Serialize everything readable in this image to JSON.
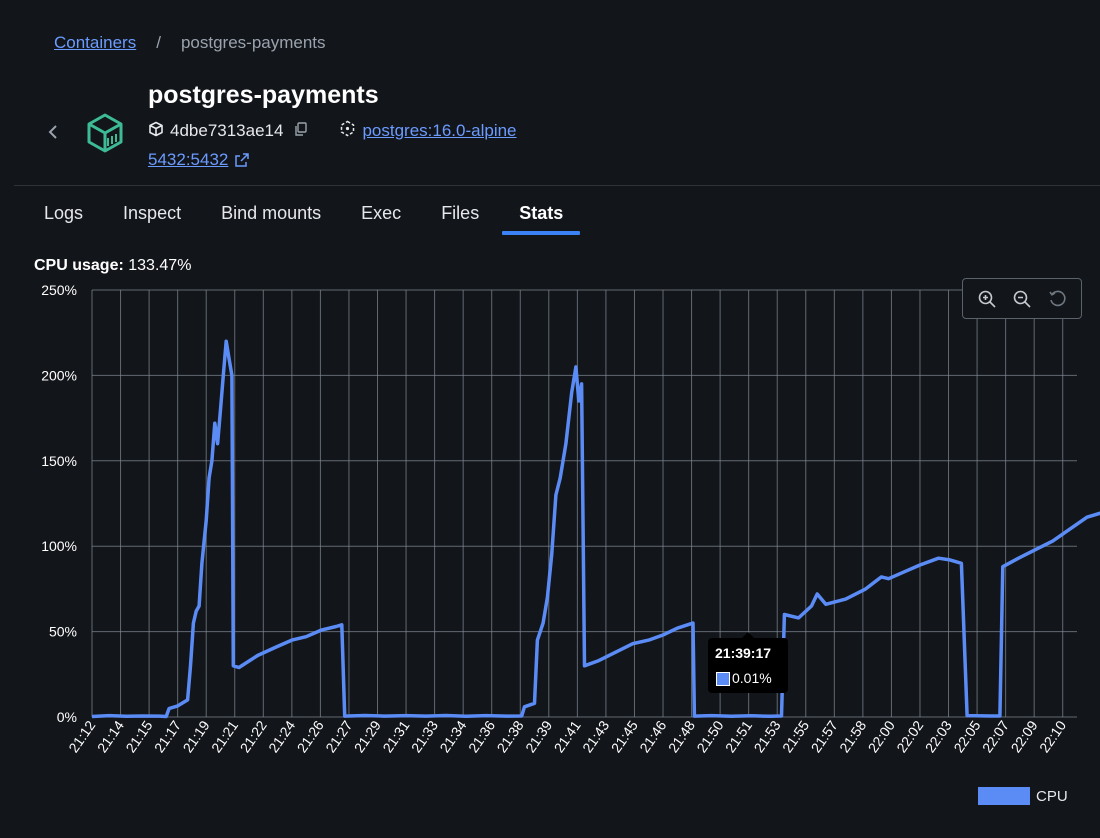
{
  "breadcrumb": {
    "root": "Containers",
    "separator": "/",
    "current": "postgres-payments"
  },
  "container": {
    "name": "postgres-payments",
    "id": "4dbe7313ae14",
    "image": "postgres:16.0-alpine",
    "port": "5432:5432",
    "icon": "container-box-icon"
  },
  "tabs": [
    {
      "label": "Logs",
      "active": false
    },
    {
      "label": "Inspect",
      "active": false
    },
    {
      "label": "Bind mounts",
      "active": false
    },
    {
      "label": "Exec",
      "active": false
    },
    {
      "label": "Files",
      "active": false
    },
    {
      "label": "Stats",
      "active": true
    }
  ],
  "stats": {
    "cpu_label": "CPU usage:",
    "cpu_value": "133.47%"
  },
  "tooltip": {
    "time": "21:39:17",
    "value": "0.01%"
  },
  "colors": {
    "accent": "#3b82f6",
    "series": "#5b8cf5",
    "background": "#12151a"
  },
  "chart_data": {
    "type": "line",
    "ylim": [
      0,
      250
    ],
    "y_ticks": [
      "0%",
      "50%",
      "100%",
      "150%",
      "200%",
      "250%"
    ],
    "x_ticks": [
      "21:12",
      "21:14",
      "21:15",
      "21:17",
      "21:19",
      "21:21",
      "21:22",
      "21:24",
      "21:26",
      "21:27",
      "21:29",
      "21:31",
      "21:33",
      "21:34",
      "21:36",
      "21:38",
      "21:39",
      "21:41",
      "21:43",
      "21:45",
      "21:46",
      "21:48",
      "21:50",
      "21:51",
      "21:53",
      "21:55",
      "21:57",
      "21:58",
      "22:00",
      "22:02",
      "22:03",
      "22:05",
      "22:07",
      "22:09",
      "22:10"
    ],
    "grid": true,
    "legend": "bottom-right",
    "series": [
      {
        "name": "CPU",
        "points": [
          [
            0.0,
            0.3
          ],
          [
            1.2,
            0.8
          ],
          [
            2.4,
            0.4
          ],
          [
            3.5,
            0.6
          ],
          [
            4.7,
            0.5
          ],
          [
            5.2,
            0.3
          ],
          [
            5.4,
            5
          ],
          [
            6.0,
            6.5
          ],
          [
            6.6,
            9.5
          ],
          [
            6.7,
            10
          ],
          [
            6.9,
            30
          ],
          [
            7.1,
            55
          ],
          [
            7.3,
            62
          ],
          [
            7.5,
            65
          ],
          [
            7.7,
            90
          ],
          [
            8.0,
            115
          ],
          [
            8.2,
            140
          ],
          [
            8.4,
            150
          ],
          [
            8.6,
            172
          ],
          [
            8.8,
            160
          ],
          [
            9.0,
            180
          ],
          [
            9.2,
            200
          ],
          [
            9.4,
            220
          ],
          [
            9.6,
            210
          ],
          [
            9.8,
            200
          ],
          [
            9.9,
            30
          ],
          [
            10.3,
            29
          ],
          [
            11.6,
            36
          ],
          [
            12.9,
            41
          ],
          [
            14.0,
            45
          ],
          [
            15.0,
            47
          ],
          [
            16.1,
            51
          ],
          [
            17.1,
            53
          ],
          [
            17.5,
            54
          ],
          [
            17.7,
            0.5
          ],
          [
            19.1,
            0.9
          ],
          [
            20.5,
            0.5
          ],
          [
            22.0,
            0.8
          ],
          [
            23.4,
            0.5
          ],
          [
            24.8,
            0.9
          ],
          [
            26.2,
            0.4
          ],
          [
            27.6,
            0.8
          ],
          [
            29.0,
            0.5
          ],
          [
            30.1,
            0.6
          ],
          [
            30.3,
            6
          ],
          [
            31.0,
            8
          ],
          [
            31.2,
            45
          ],
          [
            31.6,
            55
          ],
          [
            31.9,
            70
          ],
          [
            32.2,
            95
          ],
          [
            32.5,
            130
          ],
          [
            32.8,
            140
          ],
          [
            33.2,
            160
          ],
          [
            33.6,
            190
          ],
          [
            33.9,
            205
          ],
          [
            34.1,
            185
          ],
          [
            34.3,
            195
          ],
          [
            34.5,
            30
          ],
          [
            35.5,
            33
          ],
          [
            36.7,
            38
          ],
          [
            37.9,
            43
          ],
          [
            39.0,
            45
          ],
          [
            40.0,
            48
          ],
          [
            41.0,
            52
          ],
          [
            42.1,
            55
          ],
          [
            42.2,
            0.5
          ],
          [
            43.4,
            0.8
          ],
          [
            44.8,
            0.4
          ],
          [
            46.2,
            0.7
          ],
          [
            47.5,
            0.4
          ],
          [
            48.3,
            0.6
          ],
          [
            48.5,
            60
          ],
          [
            49.5,
            58
          ],
          [
            50.4,
            65
          ],
          [
            50.8,
            72
          ],
          [
            51.4,
            66
          ],
          [
            52.8,
            69
          ],
          [
            54.2,
            75
          ],
          [
            55.3,
            82
          ],
          [
            55.8,
            81
          ],
          [
            56.9,
            85
          ],
          [
            58.0,
            89
          ],
          [
            59.3,
            93
          ],
          [
            60.1,
            92
          ],
          [
            60.9,
            90
          ],
          [
            61.3,
            0.8
          ],
          [
            62.9,
            0.6
          ],
          [
            63.6,
            0.6
          ],
          [
            63.8,
            88
          ],
          [
            64.9,
            93
          ],
          [
            66.1,
            98
          ],
          [
            67.3,
            103
          ],
          [
            68.5,
            110
          ],
          [
            69.7,
            117
          ],
          [
            70.9,
            120
          ],
          [
            71.8,
            125
          ],
          [
            72.1,
            133.47
          ]
        ]
      }
    ]
  }
}
